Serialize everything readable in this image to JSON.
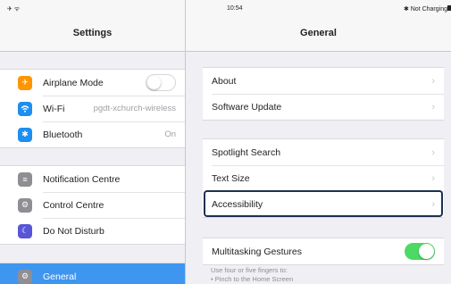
{
  "status": {
    "left": "✈ ᯤ",
    "time": "10:54",
    "right": "✱ Not Charging"
  },
  "master": {
    "title": "Settings",
    "groups": [
      {
        "items": [
          {
            "label": "Airplane Mode",
            "icon": "airplane-icon",
            "color": "#ff9500",
            "toggle": "off"
          },
          {
            "label": "Wi-Fi",
            "icon": "wifi-icon",
            "color": "#1e8ef0",
            "value": "pgdt-xchurch-wireless"
          },
          {
            "label": "Bluetooth",
            "icon": "bluetooth-icon",
            "color": "#1e8ef0",
            "value": "On"
          }
        ]
      },
      {
        "items": [
          {
            "label": "Notification Centre",
            "icon": "notification-icon",
            "color": "#8e8e93"
          },
          {
            "label": "Control Centre",
            "icon": "control-centre-icon",
            "color": "#8e8e93"
          },
          {
            "label": "Do Not Disturb",
            "icon": "moon-icon",
            "color": "#5856d6"
          }
        ]
      },
      {
        "items": [
          {
            "label": "General",
            "icon": "gear-icon",
            "color": "#8e8e93",
            "selected": true
          }
        ]
      }
    ]
  },
  "detail": {
    "title": "General",
    "groups": [
      {
        "items": [
          {
            "label": "About"
          },
          {
            "label": "Software Update"
          }
        ]
      },
      {
        "items": [
          {
            "label": "Spotlight Search"
          },
          {
            "label": "Text Size"
          },
          {
            "label": "Accessibility",
            "highlighted": true
          }
        ]
      },
      {
        "items": [
          {
            "label": "Multitasking Gestures",
            "toggle": "on"
          }
        ]
      }
    ],
    "footnote": [
      "Use four or five fingers to:",
      "• Pinch to the Home Screen"
    ]
  },
  "colors": {
    "accent": "#3e96f0",
    "toggle_on": "#4cd964",
    "highlight_border": "#1f3152"
  }
}
